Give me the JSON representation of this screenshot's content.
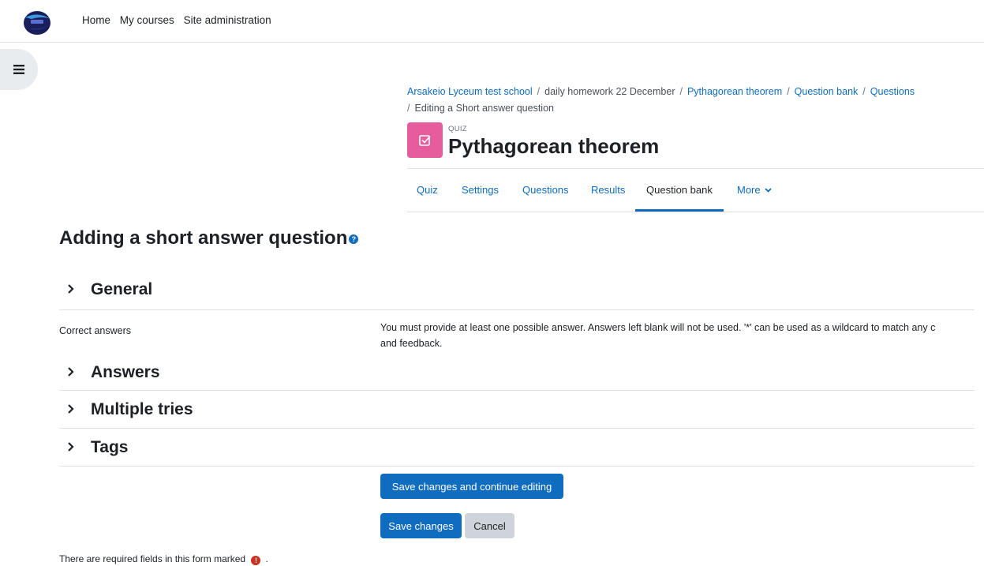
{
  "nav": {
    "links": [
      "Home",
      "My courses",
      "Site administration"
    ]
  },
  "breadcrumb": {
    "items": [
      "Arsakeio Lyceum test school",
      "daily homework 22 December",
      "Pythagorean theorem",
      "Question bank",
      "Questions"
    ],
    "current": "Editing a Short answer question",
    "separator": "/"
  },
  "activity": {
    "type_label": "QUIZ",
    "title": "Pythagorean theorem",
    "icon": "checkbox-icon",
    "icon_color": "#e65c9c"
  },
  "tabs": [
    {
      "label": "Quiz"
    },
    {
      "label": "Settings"
    },
    {
      "label": "Questions"
    },
    {
      "label": "Results"
    },
    {
      "label": "Question bank",
      "active": true
    },
    {
      "label": "More",
      "has_dropdown": true
    }
  ],
  "form": {
    "heading": "Adding a short answer question",
    "help_icon": "?",
    "sections": [
      {
        "label": "General"
      },
      {
        "label": "Answers"
      },
      {
        "label": "Multiple tries"
      },
      {
        "label": "Tags"
      }
    ],
    "correct_answers_label": "Correct answers",
    "correct_answers_note_line1": "You must provide at least one possible answer. Answers left blank will not be used. '*' can be used as a wildcard to match any c",
    "correct_answers_note_line2": "and feedback.",
    "buttons": {
      "save_continue": "Save changes and continue editing",
      "save": "Save changes",
      "cancel": "Cancel"
    },
    "required_note": "There are required fields in this form marked",
    "required_note_end": "."
  },
  "colors": {
    "primary": "#0f6cbf",
    "required": "#ca3120"
  }
}
